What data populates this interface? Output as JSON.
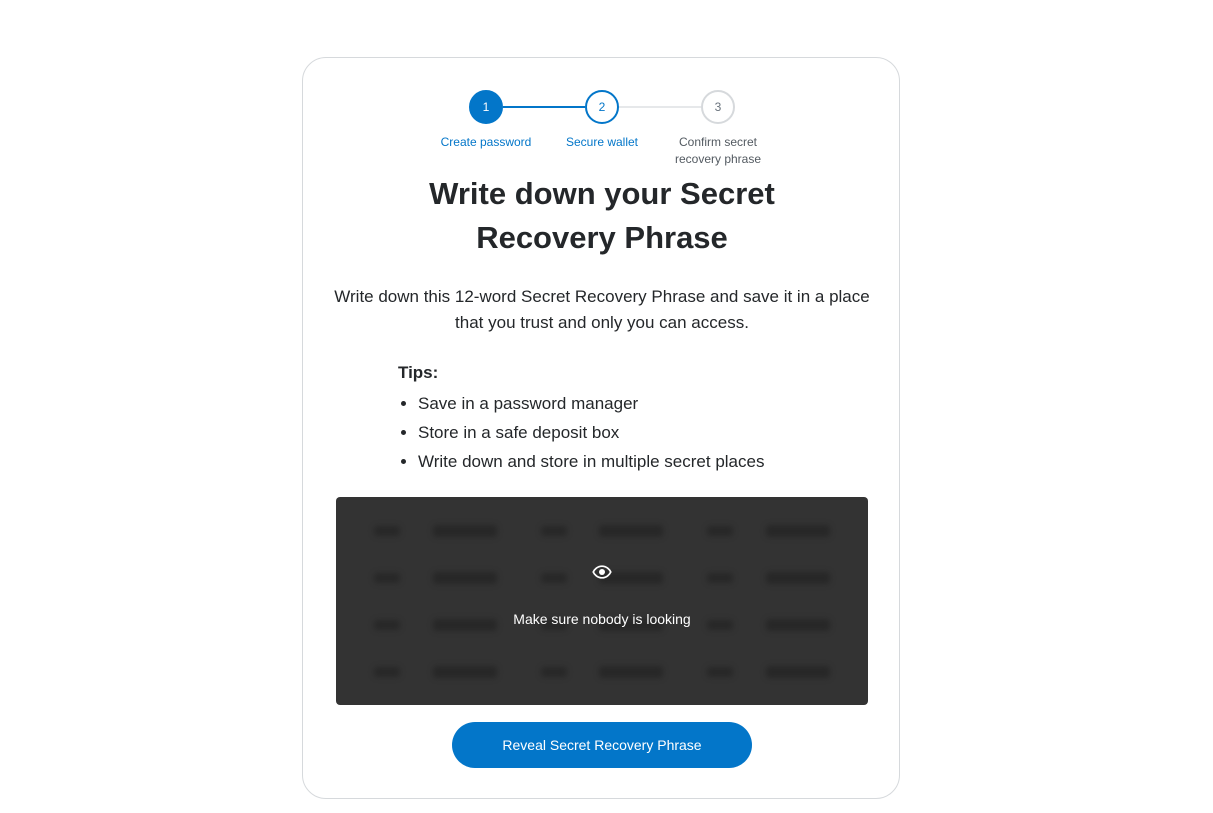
{
  "stepper": {
    "steps": [
      {
        "number": "1",
        "label": "Create password",
        "state": "complete"
      },
      {
        "number": "2",
        "label": "Secure wallet",
        "state": "active"
      },
      {
        "number": "3",
        "label": "Confirm secret recovery phrase",
        "state": "pending"
      }
    ]
  },
  "main": {
    "title": "Write down your Secret Recovery Phrase",
    "description": "Write down this 12-word Secret Recovery Phrase and save it in a place that you trust and only you can access.",
    "tips_title": "Tips:",
    "tips": [
      "Save in a password manager",
      "Store in a safe deposit box",
      "Write down and store in multiple secret places"
    ]
  },
  "phrase_box": {
    "icon": "eye-icon",
    "warning": "Make sure nobody is looking",
    "word_count": 12
  },
  "actions": {
    "reveal_label": "Reveal Secret Recovery Phrase"
  },
  "colors": {
    "accent": "#0376c9",
    "box_background": "#333333",
    "text": "#24272a"
  }
}
